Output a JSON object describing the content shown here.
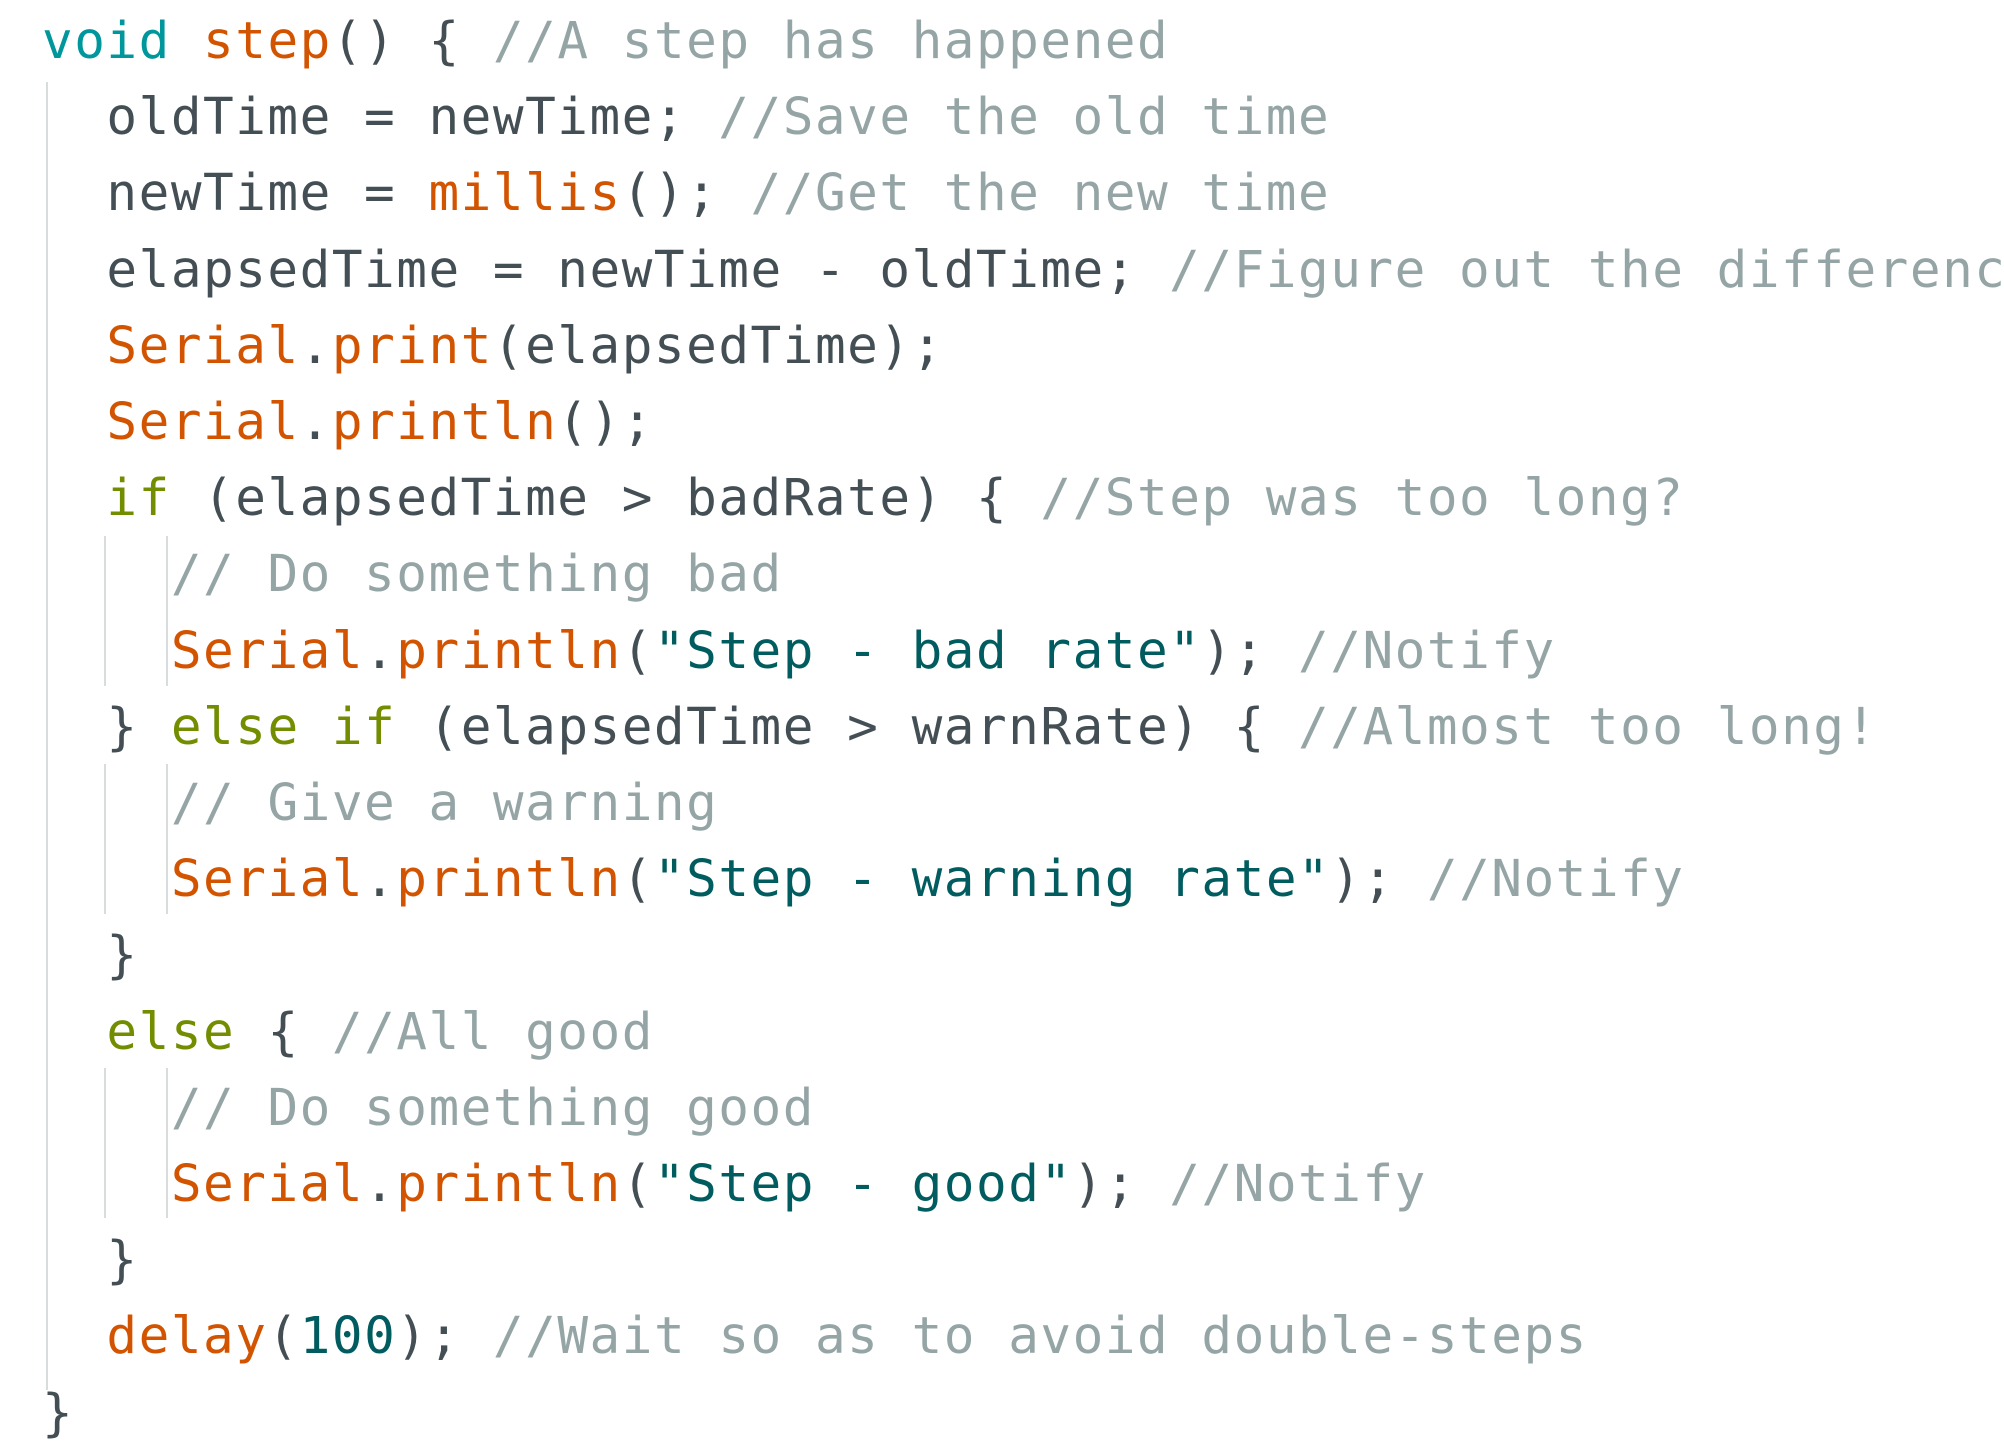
{
  "editor": {
    "colors": {
      "type_keyword": "#00979c",
      "control_keyword": "#728e00",
      "function": "#d35400",
      "string_number": "#005c5f",
      "comment": "#95a5a6",
      "text": "#434f54",
      "background": "#ffffff",
      "indent_guide": "#d9dcdd"
    },
    "lines": [
      [
        {
          "t": "void",
          "c": "kw-type"
        },
        {
          "t": " ",
          "c": "tx"
        },
        {
          "t": "step",
          "c": "fn"
        },
        {
          "t": "() { ",
          "c": "tx"
        },
        {
          "t": "//A step has happened",
          "c": "cm"
        }
      ],
      [
        {
          "t": "  oldTime = newTime; ",
          "c": "tx"
        },
        {
          "t": "//Save the old time",
          "c": "cm"
        }
      ],
      [
        {
          "t": "  newTime = ",
          "c": "tx"
        },
        {
          "t": "millis",
          "c": "fn"
        },
        {
          "t": "(); ",
          "c": "tx"
        },
        {
          "t": "//Get the new time",
          "c": "cm"
        }
      ],
      [
        {
          "t": "  elapsedTime = newTime - oldTime; ",
          "c": "tx"
        },
        {
          "t": "//Figure out the difference",
          "c": "cm"
        }
      ],
      [
        {
          "t": "  ",
          "c": "tx"
        },
        {
          "t": "Serial",
          "c": "fn"
        },
        {
          "t": ".",
          "c": "tx"
        },
        {
          "t": "print",
          "c": "fn"
        },
        {
          "t": "(elapsedTime);",
          "c": "tx"
        }
      ],
      [
        {
          "t": "  ",
          "c": "tx"
        },
        {
          "t": "Serial",
          "c": "fn"
        },
        {
          "t": ".",
          "c": "tx"
        },
        {
          "t": "println",
          "c": "fn"
        },
        {
          "t": "();",
          "c": "tx"
        }
      ],
      [
        {
          "t": "  ",
          "c": "tx"
        },
        {
          "t": "if",
          "c": "kw-ctrl"
        },
        {
          "t": " (elapsedTime > badRate) { ",
          "c": "tx"
        },
        {
          "t": "//Step was too long?",
          "c": "cm"
        }
      ],
      [
        {
          "t": "    ",
          "c": "tx"
        },
        {
          "t": "// Do something bad",
          "c": "cm"
        }
      ],
      [
        {
          "t": "    ",
          "c": "tx"
        },
        {
          "t": "Serial",
          "c": "fn"
        },
        {
          "t": ".",
          "c": "tx"
        },
        {
          "t": "println",
          "c": "fn"
        },
        {
          "t": "(",
          "c": "tx"
        },
        {
          "t": "\"Step - bad rate\"",
          "c": "str"
        },
        {
          "t": "); ",
          "c": "tx"
        },
        {
          "t": "//Notify",
          "c": "cm"
        }
      ],
      [
        {
          "t": "  } ",
          "c": "tx"
        },
        {
          "t": "else",
          "c": "kw-ctrl"
        },
        {
          "t": " ",
          "c": "tx"
        },
        {
          "t": "if",
          "c": "kw-ctrl"
        },
        {
          "t": " (elapsedTime > warnRate) { ",
          "c": "tx"
        },
        {
          "t": "//Almost too long!",
          "c": "cm"
        }
      ],
      [
        {
          "t": "    ",
          "c": "tx"
        },
        {
          "t": "// Give a warning",
          "c": "cm"
        }
      ],
      [
        {
          "t": "    ",
          "c": "tx"
        },
        {
          "t": "Serial",
          "c": "fn"
        },
        {
          "t": ".",
          "c": "tx"
        },
        {
          "t": "println",
          "c": "fn"
        },
        {
          "t": "(",
          "c": "tx"
        },
        {
          "t": "\"Step - warning rate\"",
          "c": "str"
        },
        {
          "t": "); ",
          "c": "tx"
        },
        {
          "t": "//Notify",
          "c": "cm"
        }
      ],
      [
        {
          "t": "  }",
          "c": "tx"
        }
      ],
      [
        {
          "t": "  ",
          "c": "tx"
        },
        {
          "t": "else",
          "c": "kw-ctrl"
        },
        {
          "t": " { ",
          "c": "tx"
        },
        {
          "t": "//All good",
          "c": "cm"
        }
      ],
      [
        {
          "t": "    ",
          "c": "tx"
        },
        {
          "t": "// Do something good",
          "c": "cm"
        }
      ],
      [
        {
          "t": "    ",
          "c": "tx"
        },
        {
          "t": "Serial",
          "c": "fn"
        },
        {
          "t": ".",
          "c": "tx"
        },
        {
          "t": "println",
          "c": "fn"
        },
        {
          "t": "(",
          "c": "tx"
        },
        {
          "t": "\"Step - good\"",
          "c": "str"
        },
        {
          "t": "); ",
          "c": "tx"
        },
        {
          "t": "//Notify",
          "c": "cm"
        }
      ],
      [
        {
          "t": "  }",
          "c": "tx"
        }
      ],
      [
        {
          "t": "  ",
          "c": "tx"
        },
        {
          "t": "delay",
          "c": "fn"
        },
        {
          "t": "(",
          "c": "tx"
        },
        {
          "t": "100",
          "c": "num"
        },
        {
          "t": "); ",
          "c": "tx"
        },
        {
          "t": "//Wait so as to avoid double-steps",
          "c": "cm"
        }
      ],
      [
        {
          "t": "}",
          "c": "tx"
        }
      ]
    ]
  }
}
